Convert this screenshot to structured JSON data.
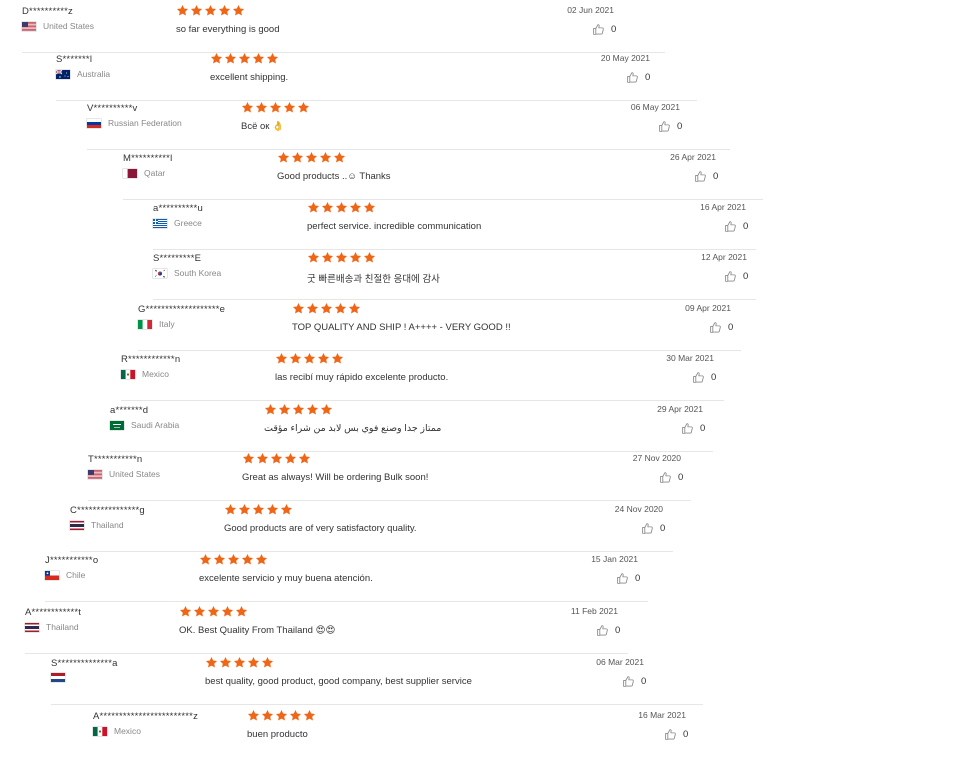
{
  "colors": {
    "star": "#f06617",
    "divider": "#e6e6e6"
  },
  "icons": {
    "star": "star-icon",
    "thumb": "thumb-up-icon"
  },
  "reviews": [
    {
      "name": "D**********z",
      "country": "United States",
      "flag": "us",
      "rating": 5,
      "text": "so far everything is good",
      "date": "02 Jun 2021",
      "likes": "0"
    },
    {
      "name": "S*******l",
      "country": "Australia",
      "flag": "au",
      "rating": 5,
      "text": "excellent shipping.",
      "date": "20 May 2021",
      "likes": "0"
    },
    {
      "name": "V**********v",
      "country": "Russian Federation",
      "flag": "ru",
      "rating": 5,
      "text": "Всё ок 👌",
      "date": "06 May 2021",
      "likes": "0"
    },
    {
      "name": "M**********l",
      "country": "Qatar",
      "flag": "qa",
      "rating": 5,
      "text": "Good products ..☺ Thanks",
      "date": "26 Apr 2021",
      "likes": "0"
    },
    {
      "name": "a**********u",
      "country": "Greece",
      "flag": "gr",
      "rating": 5,
      "text": "perfect service. incredible communication",
      "date": "16 Apr 2021",
      "likes": "0"
    },
    {
      "name": "S*********E",
      "country": "South Korea",
      "flag": "kr",
      "rating": 5,
      "text": "굿 빠른배송과 친절한 응대에 감사",
      "date": "12 Apr 2021",
      "likes": "0"
    },
    {
      "name": "G*******************e",
      "country": "Italy",
      "flag": "it",
      "rating": 5,
      "text": "TOP QUALITY AND SHIP ! A++++ - VERY GOOD !!",
      "date": "09 Apr 2021",
      "likes": "0"
    },
    {
      "name": "R************n",
      "country": "Mexico",
      "flag": "mx",
      "rating": 5,
      "text": "las recibí muy rápido excelente producto.",
      "date": "30 Mar 2021",
      "likes": "0"
    },
    {
      "name": "a*******d",
      "country": "Saudi Arabia",
      "flag": "sa",
      "rating": 5,
      "text": "ممتاز جدا وصنع فوي بس لابد من شراء مؤقت",
      "date": "29 Apr 2021",
      "likes": "0"
    },
    {
      "name": "T***********n",
      "country": "United States",
      "flag": "us",
      "rating": 5,
      "text": "Great as always! Will be ordering Bulk soon!",
      "date": "27 Nov 2020",
      "likes": "0"
    },
    {
      "name": "C****************g",
      "country": "Thailand",
      "flag": "th",
      "rating": 5,
      "text": "Good products are of very satisfactory quality.",
      "date": "24 Nov 2020",
      "likes": "0"
    },
    {
      "name": "J***********o",
      "country": "Chile",
      "flag": "cl",
      "rating": 5,
      "text": "excelente servicio y muy buena atención.",
      "date": "15 Jan 2021",
      "likes": "0"
    },
    {
      "name": "A************t",
      "country": "Thailand",
      "flag": "th",
      "rating": 5,
      "text": "OK. Best Quality From Thailand 😍😍",
      "date": "11 Feb 2021",
      "likes": "0"
    },
    {
      "name": "S**************a",
      "country": "",
      "flag": "nl",
      "rating": 5,
      "text": "best quality, good product, good company, best supplier  service",
      "date": "06 Mar 2021",
      "likes": "0"
    },
    {
      "name": "A************************z",
      "country": "Mexico",
      "flag": "mx",
      "rating": 5,
      "text": "buen producto",
      "date": "16 Mar 2021",
      "likes": "0"
    }
  ]
}
